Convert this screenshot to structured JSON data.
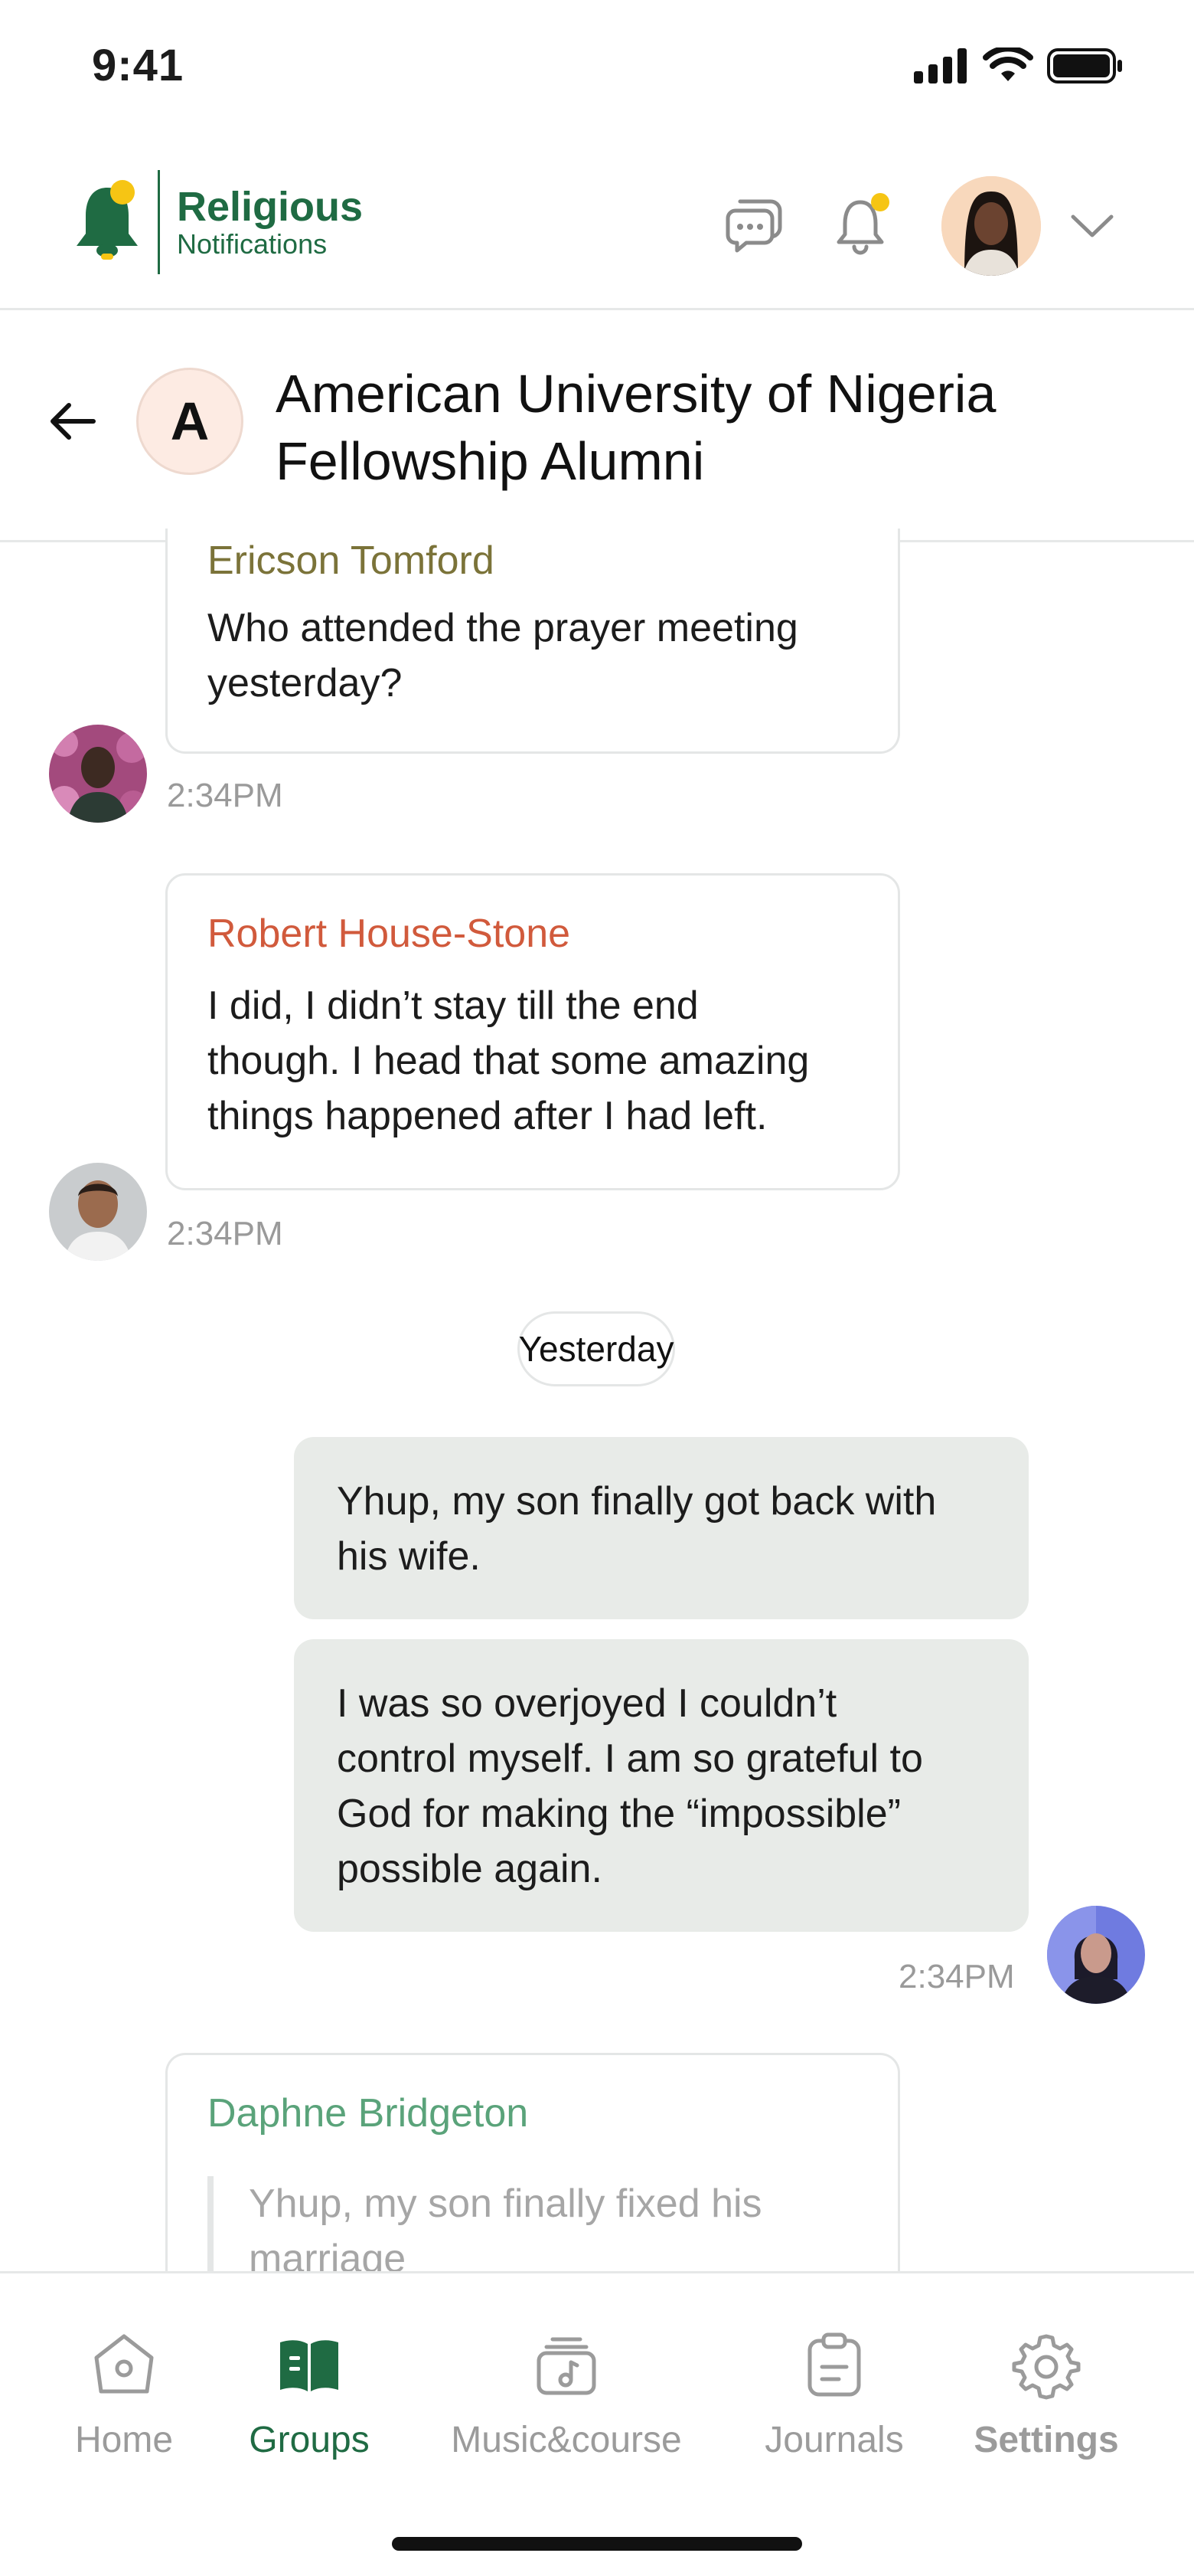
{
  "status_bar": {
    "time": "9:41"
  },
  "brand": {
    "line1": "Religious",
    "line2": "Notifications"
  },
  "header": {
    "icons": [
      "chat-icon",
      "bell-icon",
      "user-avatar",
      "chevron-down-icon"
    ]
  },
  "chat": {
    "group_initial": "A",
    "title_line1": "American University of Nigeria",
    "title_line2": "Fellowship Alumni"
  },
  "messages": [
    {
      "sender": "Ericson Tomford",
      "text_line1": "Who attended the prayer meeting",
      "text_line2": "yesterday?",
      "time": "2:34PM",
      "sender_color": "#7b7339"
    },
    {
      "sender": "Robert House-Stone",
      "text_line1": "I did, I didn’t stay till the end",
      "text_line2": "though. I head that some amazing",
      "text_line3": "things happened after I had left.",
      "time": "2:34PM",
      "sender_color": "#d15a3c"
    }
  ],
  "day_separator": "Yesterday",
  "outgoing": {
    "bubble1_line1": "Yhup, my son finally got back with",
    "bubble1_line2": "his wife.",
    "bubble2_line1": "I was so overjoyed I couldn’t",
    "bubble2_line2": "control myself. I am so grateful to",
    "bubble2_line3": "God for making the “impossible”",
    "bubble2_line4": "possible again.",
    "time": "2:34PM"
  },
  "reply_message": {
    "sender": "Daphne Bridgeton",
    "sender_color": "#5aa37a",
    "quote_line1": "Yhup, my son finally fixed his",
    "quote_line2": "marriage"
  },
  "bottom_nav": {
    "items": [
      {
        "label": "Home",
        "icon": "home-icon",
        "active": false
      },
      {
        "label": "Groups",
        "icon": "book-icon",
        "active": true
      },
      {
        "label": "Music&course",
        "icon": "music-icon",
        "active": false
      },
      {
        "label": "Journals",
        "icon": "clipboard-icon",
        "active": false
      },
      {
        "label": "Settings",
        "icon": "gear-icon",
        "active": false
      }
    ],
    "active_color": "#1f6b43"
  }
}
